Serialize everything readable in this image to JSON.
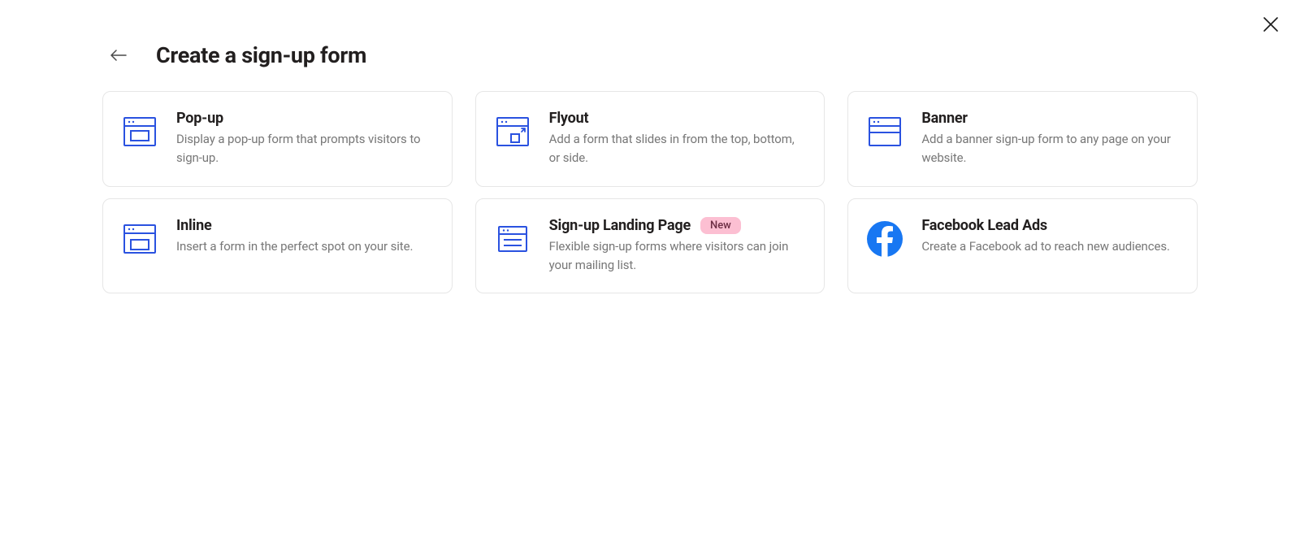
{
  "title": "Create a sign-up form",
  "cards": [
    {
      "title": "Pop-up",
      "desc": "Display a pop-up form that prompts visitors to sign-up."
    },
    {
      "title": "Flyout",
      "desc": "Add a form that slides in from the top, bottom, or side."
    },
    {
      "title": "Banner",
      "desc": "Add a banner sign-up form to any page on your website."
    },
    {
      "title": "Inline",
      "desc": "Insert a form in the perfect spot on your site."
    },
    {
      "title": "Sign-up Landing Page",
      "desc": "Flexible sign-up forms where visitors can join your mailing list.",
      "badge": "New"
    },
    {
      "title": "Facebook Lead Ads",
      "desc": "Create a Facebook ad to reach new audiences."
    }
  ]
}
